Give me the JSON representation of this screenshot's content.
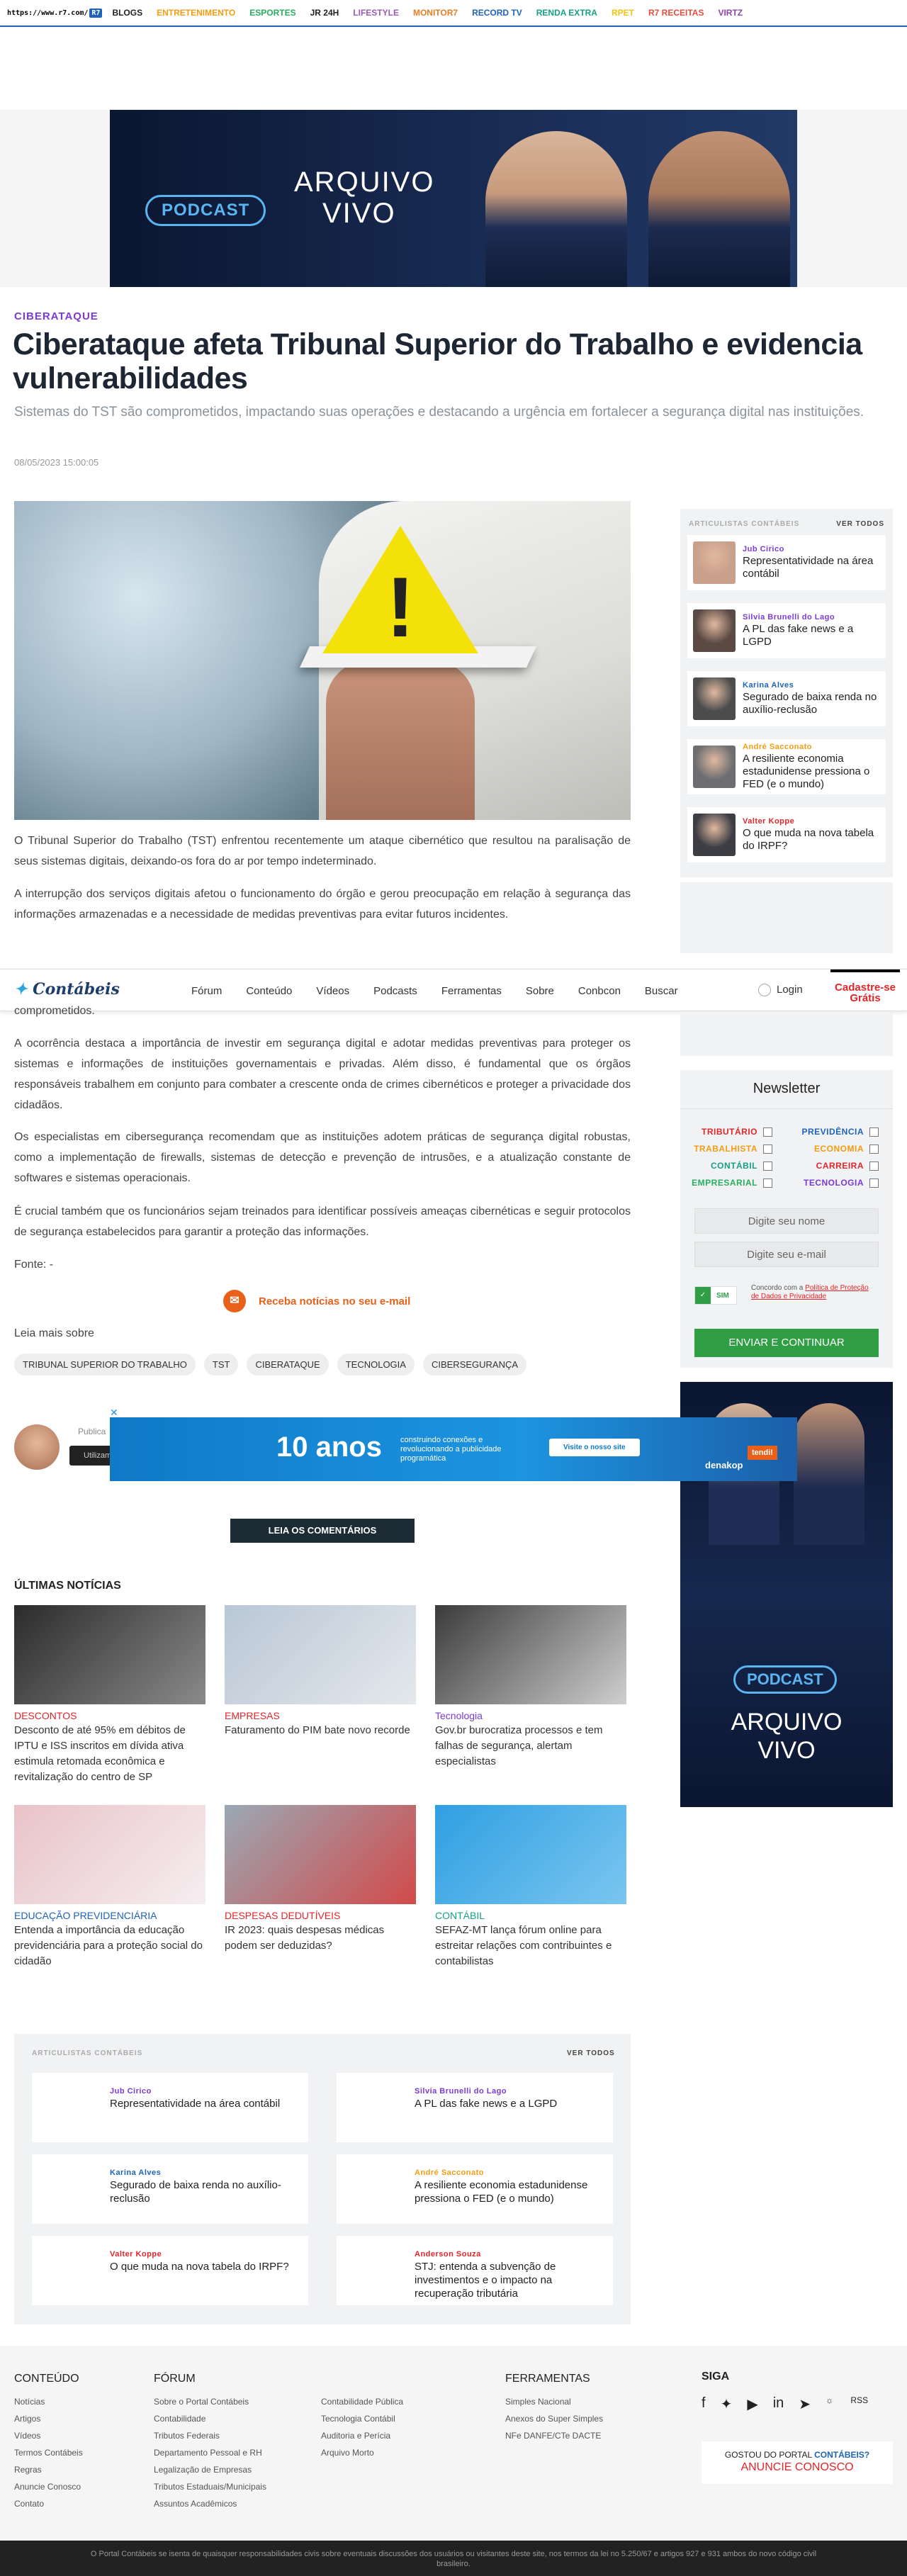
{
  "r7": {
    "logo_text": "https://www.r7.com/",
    "items": [
      {
        "label": "BLOGS",
        "color": "#222222"
      },
      {
        "label": "ENTRETENIMENTO",
        "color": "#f39c12"
      },
      {
        "label": "ESPORTES",
        "color": "#27ae60"
      },
      {
        "label": "JR 24H",
        "color": "#222222"
      },
      {
        "label": "LIFESTYLE",
        "color": "#9b59b6"
      },
      {
        "label": "MONITOR7",
        "color": "#e67e22"
      },
      {
        "label": "RECORD TV",
        "color": "#1d63b8"
      },
      {
        "label": "RENDA EXTRA",
        "color": "#16a085"
      },
      {
        "label": "RPET",
        "color": "#f1c40f"
      },
      {
        "label": "R7 RECEITAS",
        "color": "#e74c3c"
      },
      {
        "label": "VIRTZ",
        "color": "#8e44ad"
      }
    ]
  },
  "banner": {
    "podcast": "PODCAST",
    "arquivo": "ARQUIVO",
    "vivo": "VIVO"
  },
  "article": {
    "category": "CIBERATAQUE",
    "title": "Ciberataque afeta Tribunal Superior do Trabalho e evidencia vulnerabilidades",
    "subtitle": "Sistemas do TST são comprometidos, impactando suas operações e destacando a urgência em fortalecer a segurança digital nas instituições.",
    "date": "08/05/2023 15:00:05",
    "p1": "O Tribunal Superior do Trabalho (TST) enfrentou recentemente um ataque cibernético que resultou na paralisação de seus sistemas digitais, deixando-os fora do ar por tempo indeterminado.",
    "p2": "A interrupção dos serviços digitais afetou o funcionamento do órgão e gerou preocupação em relação à segurança das informações armazenadas e a necessidade de medidas preventivas para evitar futuros incidentes.",
    "p3": "comprometidos.",
    "p4": "A ocorrência destaca a importância de investir em segurança digital e adotar medidas preventivas para proteger os sistemas e informações de instituições governamentais e privadas. Além disso, é fundamental que os órgãos responsáveis trabalhem em conjunto para combater a crescente onda de crimes cibernéticos e proteger a privacidade dos cidadãos.",
    "p5": "Os especialistas em cibersegurança recomendam que as instituições adotem práticas de segurança digital robustas, como a implementação de firewalls, sistemas de detecção e prevenção de intrusões, e a atualização constante de softwares e sistemas operacionais.",
    "p6": "É crucial também que os funcionários sejam treinados para identificar possíveis ameaças cibernéticas e seguir protocolos de segurança estabelecidos para garantir a proteção das informações.",
    "fonte": "Fonte: -",
    "receba": "Receba notícias no seu e-mail",
    "leia_mais": "Leia mais sobre",
    "tags": [
      "TRIBUNAL SUPERIOR DO TRABALHO",
      "TST",
      "CIBERATAQUE",
      "TECNOLOGIA",
      "CIBERSEGURANÇA"
    ],
    "publicado": "Publica",
    "cookie": "Utilizamo",
    "comments_btn": "LEIA OS COMENTÁRIOS"
  },
  "sidebar_articles": {
    "header": "ARTICULISTAS CONTÁBEIS",
    "ver_todos": "VER TODOS",
    "items": [
      {
        "name": "Jub Cirico",
        "name_color": "#7a3ad6",
        "text": "Representatividade na área contábil",
        "avatar": "#c9a08a"
      },
      {
        "name": "Silvia Brunelli do Lago",
        "name_color": "#7a3ad6",
        "text": "A PL das fake news e a LGPD",
        "avatar": "#5b4a44"
      },
      {
        "name": "Karina Alves",
        "name_color": "#1d63b8",
        "text": "Segurado de baixa renda no auxílio-reclusão",
        "avatar": "#4c4c4c"
      },
      {
        "name": "André Sacconato",
        "name_color": "#f39c12",
        "text": "A resiliente economia estadunidense pressiona o FED (e o mundo)",
        "avatar": "#6e6e72"
      },
      {
        "name": "Valter Koppe",
        "name_color": "#e3252a",
        "text": "O que muda na nova tabela do IRPF?",
        "avatar": "#3d3d44"
      }
    ]
  },
  "header": {
    "logo_a": "Contá",
    "logo_b": "beis",
    "nav": [
      "Fórum",
      "Conteúdo",
      "Vídeos",
      "Podcasts",
      "Ferramentas",
      "Sobre",
      "Conbcon",
      "Buscar"
    ],
    "login": "Login",
    "cadastre": "Cadastre-se",
    "gratis": "Grátis"
  },
  "newsletter": {
    "title": "Newsletter",
    "topics": [
      {
        "label": "TRIBUTÁRIO",
        "color": "#e3252a"
      },
      {
        "label": "PREVIDÊNCIA",
        "color": "#1d63b8"
      },
      {
        "label": "TRABALHISTA",
        "color": "#f39c12"
      },
      {
        "label": "ECONOMIA",
        "color": "#f39c12"
      },
      {
        "label": "CONTÁBIL",
        "color": "#16a085"
      },
      {
        "label": "CARREIRA",
        "color": "#e3252a"
      },
      {
        "label": "EMPRESARIAL",
        "color": "#27ae60"
      },
      {
        "label": "TECNOLOGIA",
        "color": "#7a3ad6"
      }
    ],
    "name_placeholder": "Digite seu nome",
    "email_placeholder": "Digite seu e-mail",
    "sim": "SIM",
    "agree_a": "Concordo com a ",
    "agree_link": "Política de Proteção de Dados e Privacidade",
    "submit": "ENVIAR E CONTINUAR"
  },
  "float_ad": {
    "num": "10 anos",
    "text": "construindo conexões e revolucionando a publicidade programática",
    "btn": "Visite o nosso site",
    "logo": "denakop",
    "cta": "tendi!"
  },
  "ultimas": {
    "title": "ÚLTIMAS NOTÍCIAS",
    "items": [
      {
        "cat": "DESCONTOS",
        "cat_color": "#e3252a",
        "text": "Desconto de até 95% em débitos de IPTU e ISS inscritos em dívida ativa estimula retomada econômica e revitalização do centro de SP",
        "img": "linear-gradient(135deg,#2b2b2b,#8a8a8a)"
      },
      {
        "cat": "EMPRESAS",
        "cat_color": "#e3252a",
        "text": "Faturamento do PIM bate novo recorde",
        "img": "linear-gradient(135deg,#b9c7d6,#e4e8ec)"
      },
      {
        "cat": "Tecnologia",
        "cat_color": "#7a3ad6",
        "text": "Gov.br burocratiza processos e tem falhas de segurança, alertam especialistas",
        "img": "linear-gradient(135deg,#3b3b3b,#cfcfcf)"
      },
      {
        "cat": "EDUCAÇÃO PREVIDENCIÁRIA",
        "cat_color": "#1d63b8",
        "text": "Entenda a importância da educação previdenciária para a proteção social do cidadão",
        "img": "linear-gradient(135deg,#e8c3c8,#f6eef0)"
      },
      {
        "cat": "DESPESAS DEDUTÍVEIS",
        "cat_color": "#e3252a",
        "text": "IR 2023: quais despesas médicas podem ser deduzidas?",
        "img": "linear-gradient(135deg,#9aa9b5,#d24a4a)"
      },
      {
        "cat": "CONTÁBIL",
        "cat_color": "#16a085",
        "text": "SEFAZ-MT lança fórum online para estreitar relações com contribuintes e contabilistas",
        "img": "linear-gradient(135deg,#2f9fe2,#7ac6ef)"
      }
    ]
  },
  "bottom_articles": {
    "header": "ARTICULISTAS CONTÁBEIS",
    "ver_todos": "VER TODOS",
    "items": [
      {
        "name": "Jub Cirico",
        "name_color": "#7a3ad6",
        "text": "Representatividade na área contábil"
      },
      {
        "name": "Silvia Brunelli do Lago",
        "name_color": "#7a3ad6",
        "text": "A PL das fake news e a LGPD"
      },
      {
        "name": "Karina Alves",
        "name_color": "#1d63b8",
        "text": "Segurado de baixa renda no auxílio-reclusão"
      },
      {
        "name": "André Sacconato",
        "name_color": "#f39c12",
        "text": "A resiliente economia estadunidense pressiona o FED (e o mundo)"
      },
      {
        "name": "Valter Koppe",
        "name_color": "#e3252a",
        "text": "O que muda na nova tabela do IRPF?"
      },
      {
        "name": "Anderson Souza",
        "name_color": "#e3252a",
        "text": "STJ: entenda a subvenção de investimentos e o impacto na recuperação tributária"
      }
    ]
  },
  "footer": {
    "conteudo": {
      "title": "CONTEÚDO",
      "items": [
        "Notícias",
        "Artigos",
        "Vídeos",
        "Termos Contábeis",
        "Regras",
        "Anuncie Conosco",
        "Contato"
      ]
    },
    "forum": {
      "title": "FÓRUM",
      "items": [
        "Sobre o Portal Contábeis",
        "Contabilidade",
        "Tributos Federais",
        "Departamento Pessoal e RH",
        "Legalização de Empresas",
        "Tributos Estaduais/Municipais",
        "Assuntos Acadêmicos"
      ]
    },
    "forum2": {
      "items": [
        "Contabilidade Pública",
        "Tecnologia Contábil",
        "Auditoria e Perícia",
        "Arquivo Morto"
      ]
    },
    "ferramentas": {
      "title": "FERRAMENTAS",
      "items": [
        "Simples Nacional",
        "Anexos do Super Simples",
        "NFe DANFE/CTe DACTE"
      ]
    },
    "siga": "SIGA",
    "rss": "RSS",
    "gostou_a": "GOSTOU DO PORTAL ",
    "gostou_b": "CONTÁBEIS?",
    "anuncie": "ANUNCIE CONOSCO",
    "disclaimer": "O Portal Contábeis se isenta de quaisquer responsabilidades civis sobre eventuais discussões dos usuários ou visitantes deste site, nos termos da lei no 5.250/67 e artigos 927 e 931 ambos do novo código civil brasileiro."
  }
}
